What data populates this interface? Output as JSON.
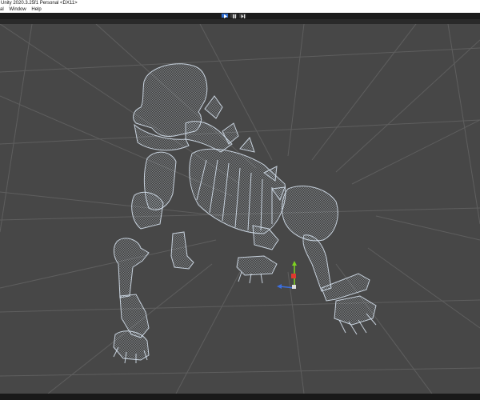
{
  "window": {
    "title": "Unity 2020.3.25f1 Personal <DX11>"
  },
  "menu": {
    "items": [
      "al",
      "Window",
      "Help"
    ]
  },
  "toolbar": {
    "play_icon": "play-icon",
    "pause_icon": "pause-icon",
    "step_icon": "step-icon"
  },
  "scene": {
    "object": "skeleton-wireframe",
    "gizmo": {
      "x_color": "#3b6fe0",
      "y_color": "#7ed321",
      "z_color": "#e0392f"
    },
    "colors": {
      "background": "#474747",
      "grid": "#5a5a5a",
      "wire": "#c8dcf0"
    }
  }
}
